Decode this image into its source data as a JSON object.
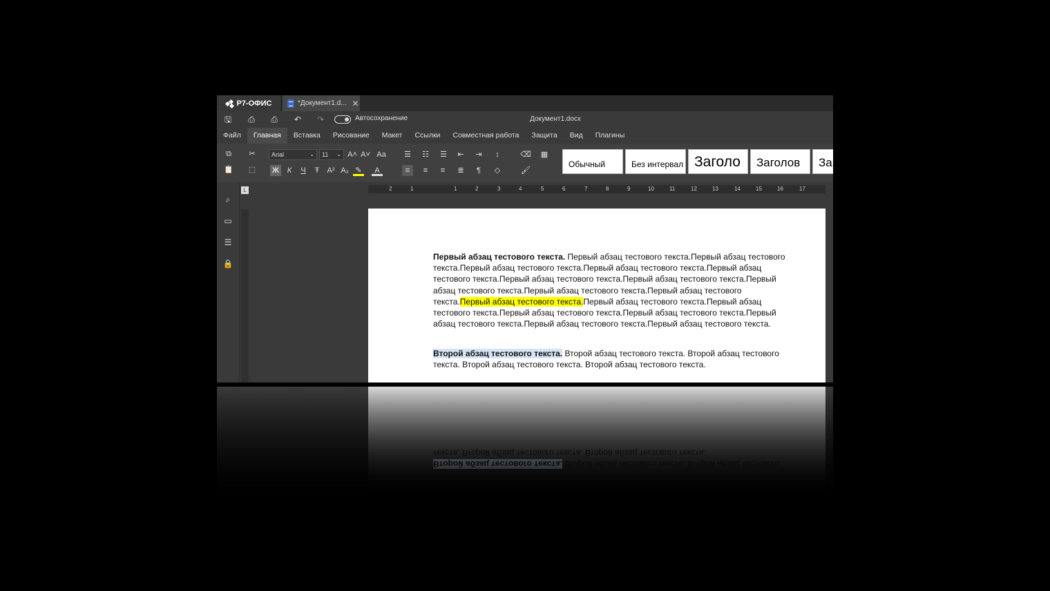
{
  "app": {
    "logo": "Р7-ОФИС",
    "tab_title": "*Документ1.d...",
    "window_title": "Документ1.docx",
    "autosave_label": "Автосохранение",
    "autosave_on": true
  },
  "menu": {
    "items": [
      "Файл",
      "Главная",
      "Вставка",
      "Рисование",
      "Макет",
      "Ссылки",
      "Совместная работа",
      "Защита",
      "Вид",
      "Плагины"
    ],
    "active": "Главная"
  },
  "toolbar": {
    "font_name": "Arial",
    "font_size": "11",
    "bold": "Ж",
    "italic": "К",
    "underline": "Ч",
    "strike": "Ŧ",
    "styles": [
      "Обычный",
      "Без интервал",
      "Заголо",
      "Заголов",
      "Заг"
    ]
  },
  "ruler": {
    "marks": [
      "2",
      "1",
      "1",
      "2",
      "3",
      "4",
      "5",
      "6",
      "7",
      "8",
      "9",
      "10",
      "11",
      "12",
      "13",
      "14",
      "15",
      "16",
      "17"
    ]
  },
  "document": {
    "p1_bold": "Первый абзац тестового текста.",
    "p1_a": " Первый абзац тестового текста.Первый абзац тестового текста.Первый абзац тестового текста.Первый абзац тестового текста.Первый абзац тестового текста.Первый абзац тестового текста.Первый абзац тестового текста.Первый абзац тестового текста.Первый абзац тестового текста.Первый абзац тестового текста.",
    "p1_highlight": "Первый абзац тестового текста.",
    "p1_b": "Первый абзац тестового текста.Первый абзац тестового текста.Первый абзац тестового текста.Первый абзац тестового текста.Первый абзац тестового текста.Первый абзац тестового текста.Первый абзац тестового текста.",
    "p2_bold": "Второй абзац тестового текста.",
    "p2_rest": " Второй абзац тестового текста. Второй абзац тестового текста. Второй абзац тестового текста. Второй абзац тестового текста."
  },
  "colors": {
    "highlight": "#ffff00",
    "selection": "#d6e4f5",
    "active_tab": "#4a4a4a"
  }
}
